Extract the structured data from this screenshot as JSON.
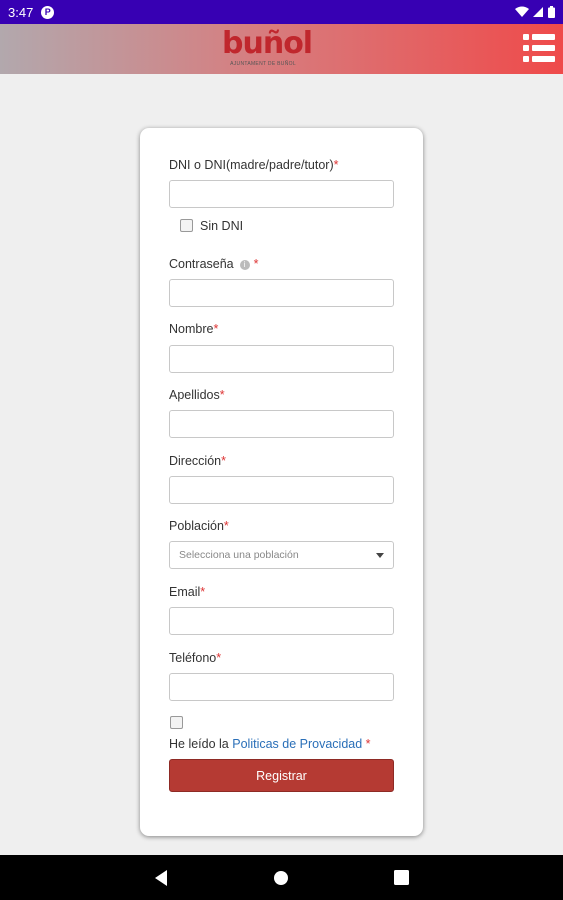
{
  "status_bar": {
    "time": "3:47",
    "notification_glyph": "P"
  },
  "header": {
    "logo_text": "buñol",
    "logo_subtitle": "AJUNTAMENT DE BUÑOL",
    "brand_color": "#c0272d"
  },
  "form": {
    "dni": {
      "label": "DNI o DNI(madre/padre/tutor)",
      "required_mark": "*",
      "value": ""
    },
    "sin_dni": {
      "label": "Sin DNI",
      "checked": false
    },
    "password": {
      "label": "Contraseña",
      "info_glyph": "i",
      "required_mark": "*",
      "value": ""
    },
    "nombre": {
      "label": "Nombre",
      "required_mark": "*",
      "value": ""
    },
    "apellidos": {
      "label": "Apellidos",
      "required_mark": "*",
      "value": ""
    },
    "direccion": {
      "label": "Dirección",
      "required_mark": "*",
      "value": ""
    },
    "poblacion": {
      "label": "Población",
      "required_mark": "*",
      "selected": "Selecciona una población"
    },
    "email": {
      "label": "Email",
      "required_mark": "*",
      "value": ""
    },
    "telefono": {
      "label": "Teléfono",
      "required_mark": "*",
      "value": ""
    },
    "privacy": {
      "checked": false,
      "prefix": "He leído la",
      "link_text": "Politicas de Provacidad",
      "required_mark": "*"
    },
    "submit_label": "Registrar",
    "accent_color": "#b53a33"
  }
}
